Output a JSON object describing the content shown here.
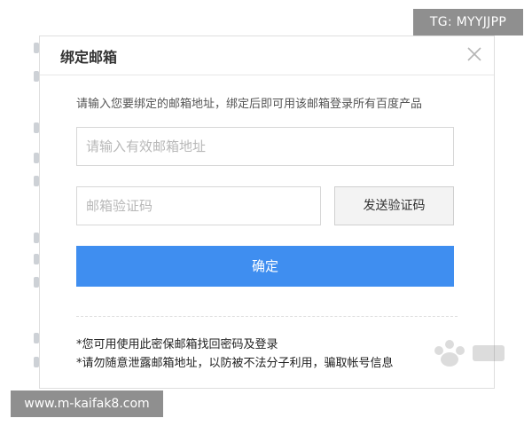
{
  "dialog": {
    "title": "绑定邮箱",
    "instruction": "请输入您要绑定的邮箱地址，绑定后即可用该邮箱登录所有百度产品",
    "email_placeholder": "请输入有效邮箱地址",
    "email_value": "",
    "code_placeholder": "邮箱验证码",
    "code_value": "",
    "send_code_label": "发送验证码",
    "confirm_label": "确定",
    "notes": [
      "*您可用使用此密保邮箱找回密码及登录",
      "*请勿随意泄露邮箱地址，以防被不法分子利用，骗取帐号信息"
    ],
    "close_icon": "close-icon",
    "accent_color": "#3f8ef0"
  },
  "overlays": {
    "tg": "TG: MYYJJPP",
    "site": "www.m-kaifak8.com"
  }
}
